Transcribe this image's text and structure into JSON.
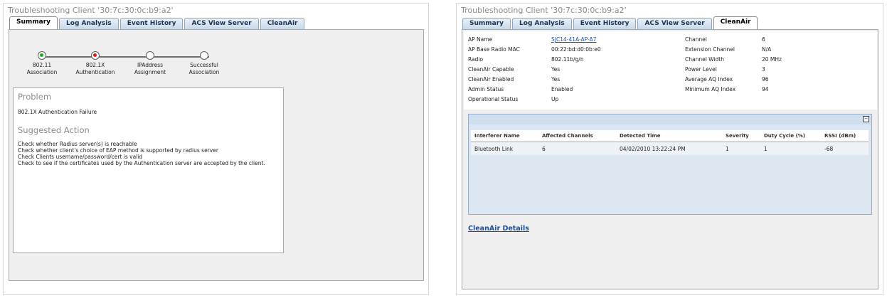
{
  "left": {
    "title": "Troubleshooting Client '30:7c:30:0c:b9:a2'",
    "tabs": [
      "Summary",
      "Log Analysis",
      "Event History",
      "ACS View Server",
      "CleanAir"
    ],
    "active_tab": "Summary",
    "steps": [
      {
        "label1": "802.11",
        "label2": "Association",
        "status": "green"
      },
      {
        "label1": "802.1X",
        "label2": "Authentication",
        "status": "red"
      },
      {
        "label1": "IPAddress",
        "label2": "Assignment",
        "status": "empty"
      },
      {
        "label1": "Successful",
        "label2": "Association",
        "status": "empty"
      }
    ],
    "problem_heading": "Problem",
    "problem_text": "802.1X Authentication Failure",
    "action_heading": "Suggested Action",
    "actions": [
      "Check whether Radius server(s) is reachable",
      "Check whether client's choice of EAP method is supported by radius server",
      "Check Clients username/password/cert is valid",
      "Check to see if the certificates used by the Authentication server are accepted by the client."
    ]
  },
  "right": {
    "title": "Troubleshooting Client '30:7c:30:0c:b9:a2'",
    "tabs": [
      "Summary",
      "Log Analysis",
      "Event History",
      "ACS View Server",
      "CleanAir"
    ],
    "active_tab": "CleanAir",
    "info_left": [
      {
        "label": "AP Name",
        "value": "SJC14-41A-AP-A7"
      },
      {
        "label": "AP Base Radio MAC",
        "value": "00:22:bd:d0:0b:e0"
      },
      {
        "label": "Radio",
        "value": "802.11b/g/n"
      },
      {
        "label": "CleanAir Capable",
        "value": "Yes"
      },
      {
        "label": "CleanAir Enabled",
        "value": "Yes"
      },
      {
        "label": "Admin Status",
        "value": "Enabled"
      },
      {
        "label": "Operational Status",
        "value": "Up"
      }
    ],
    "info_right": [
      {
        "label": "Channel",
        "value": "6"
      },
      {
        "label": "Extension Channel",
        "value": "N/A"
      },
      {
        "label": "Channel Width",
        "value": "20 MHz"
      },
      {
        "label": "Power Level",
        "value": "3"
      },
      {
        "label": "Average AQ Index",
        "value": "96"
      },
      {
        "label": "Minimum AQ Index",
        "value": "94"
      }
    ],
    "collapse_symbol": "–",
    "table_headers": [
      "Interferer Name",
      "Affected Channels",
      "Detected Time",
      "Severity",
      "Duty Cycle (%)",
      "RSSI (dBm)"
    ],
    "table_rows": [
      [
        "Bluetooth Link",
        "6",
        "04/02/2010 13:22:24 PM",
        "1",
        "1",
        "-68"
      ]
    ],
    "details_link": "CleanAir Details"
  },
  "colors": {
    "tab_text": "#1e3150",
    "link": "#1a4fa0",
    "status_green": "#18b018",
    "status_red": "#e01818"
  }
}
